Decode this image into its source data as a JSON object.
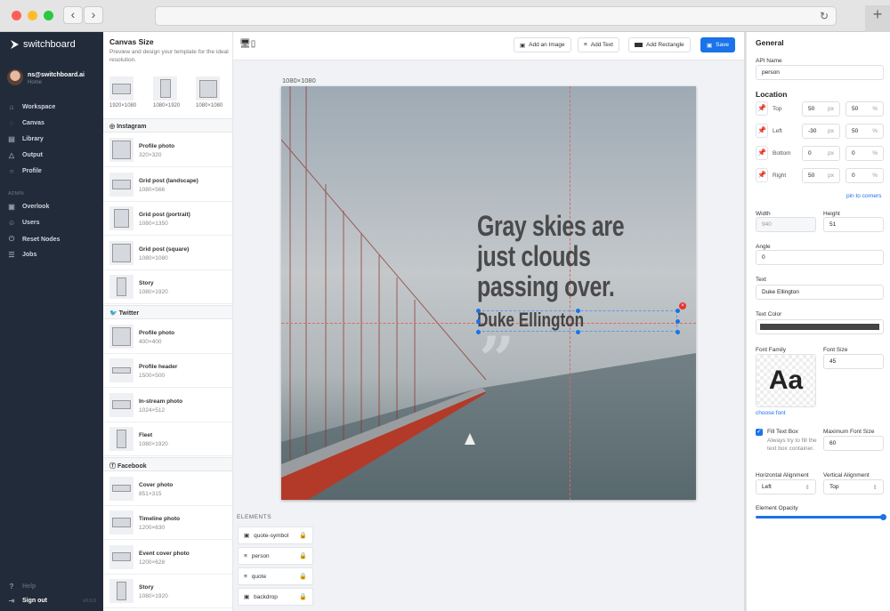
{
  "browser": {
    "back": "‹",
    "forward": "›",
    "reload": "↻",
    "new_tab": "+"
  },
  "sidebar": {
    "brand": "switchboard",
    "user": {
      "email": "ns@switchboard.ai",
      "subtitle": "Home"
    },
    "items": [
      {
        "label": "Workspace",
        "icon": "workspace-icon"
      },
      {
        "label": "Canvas",
        "icon": "palette-icon"
      },
      {
        "label": "Library",
        "icon": "library-icon"
      },
      {
        "label": "Output",
        "icon": "output-icon"
      },
      {
        "label": "Profile",
        "icon": "user-icon"
      }
    ],
    "admin_label": "ADMIN",
    "admin_items": [
      {
        "label": "Overlook",
        "icon": "binoculars-icon"
      },
      {
        "label": "Users",
        "icon": "users-icon"
      },
      {
        "label": "Reset Nodes",
        "icon": "power-icon"
      },
      {
        "label": "Jobs",
        "icon": "list-icon"
      }
    ],
    "help": "Help",
    "sign_out": "Sign out",
    "version": "v0.0.0"
  },
  "canvas_size": {
    "title": "Canvas Size",
    "description": "Preview and design your template for the ideal resolution.",
    "quick": [
      "1920×1080",
      "1080×1920",
      "1080×1080"
    ],
    "sections": [
      {
        "name": "Instagram",
        "items": [
          {
            "t": "Profile photo",
            "s": "320×320"
          },
          {
            "t": "Grid post (landscape)",
            "s": "1080×566"
          },
          {
            "t": "Grid post (portrait)",
            "s": "1080×1350"
          },
          {
            "t": "Grid post (square)",
            "s": "1080×1080"
          },
          {
            "t": "Story",
            "s": "1080×1920"
          }
        ]
      },
      {
        "name": "Twitter",
        "items": [
          {
            "t": "Profile photo",
            "s": "400×400"
          },
          {
            "t": "Profile header",
            "s": "1500×500"
          },
          {
            "t": "In-stream photo",
            "s": "1024×512"
          },
          {
            "t": "Fleet",
            "s": "1080×1920"
          }
        ]
      },
      {
        "name": "Facebook",
        "items": [
          {
            "t": "Cover photo",
            "s": "851×315"
          },
          {
            "t": "Timeline photo",
            "s": "1200×630"
          },
          {
            "t": "Event cover photo",
            "s": "1200×628"
          },
          {
            "t": "Story",
            "s": "1080×1920"
          }
        ]
      }
    ]
  },
  "toolbar": {
    "add_image": "Add an Image",
    "add_text": "Add Text",
    "add_rectangle": "Add Rectangle",
    "save": "Save"
  },
  "canvas": {
    "dimensions": "1080×1080",
    "quote": "Gray skies are just clouds passing over.",
    "person": "Duke Ellington",
    "quote_symbol": "”"
  },
  "elements": {
    "title": "ELEMENTS",
    "items": [
      {
        "name": "quote-symbol",
        "type": "image",
        "locked": false
      },
      {
        "name": "person",
        "type": "text",
        "locked": false
      },
      {
        "name": "quote",
        "type": "text",
        "locked": false
      },
      {
        "name": "backdrop",
        "type": "image",
        "locked": true
      }
    ]
  },
  "properties": {
    "general": "General",
    "api_name_label": "API Name",
    "api_name": "person",
    "location": "Location",
    "rows": [
      {
        "label": "Top",
        "px": "50",
        "pct": "50",
        "pinned": false
      },
      {
        "label": "Left",
        "px": "-30",
        "pct": "50",
        "pinned": true
      },
      {
        "label": "Bottom",
        "px": "0",
        "pct": "0",
        "pinned": false
      },
      {
        "label": "Right",
        "px": "50",
        "pct": "0",
        "pinned": true
      }
    ],
    "px_unit": "px",
    "pct_unit": "%",
    "pin_to_corners": "pin to corners",
    "width_label": "Width",
    "width": "940",
    "height_label": "Height",
    "height": "51",
    "angle_label": "Angle",
    "angle": "0",
    "text_label": "Text",
    "text": "Duke Ellington",
    "text_color_label": "Text Color",
    "text_color": "#444444",
    "font_family_label": "Font Family",
    "font_preview": "Aa",
    "choose_font": "choose font",
    "font_size_label": "Font Size",
    "font_size": "45",
    "fill_text_box": "Fill Text Box",
    "fill_text_box_checked": true,
    "fill_text_box_help": "Always try to fill the text box container.",
    "max_font_size_label": "Maximum Font Size",
    "max_font_size": "60",
    "h_align_label": "Horizontal Alignment",
    "h_align": "Left",
    "v_align_label": "Vertical Alignment",
    "v_align": "Top",
    "opacity_label": "Element Opacity",
    "opacity": 1.0
  },
  "colors": {
    "sidebar": "#222b3a",
    "accent": "#1a73e8",
    "delete": "#e33333"
  }
}
